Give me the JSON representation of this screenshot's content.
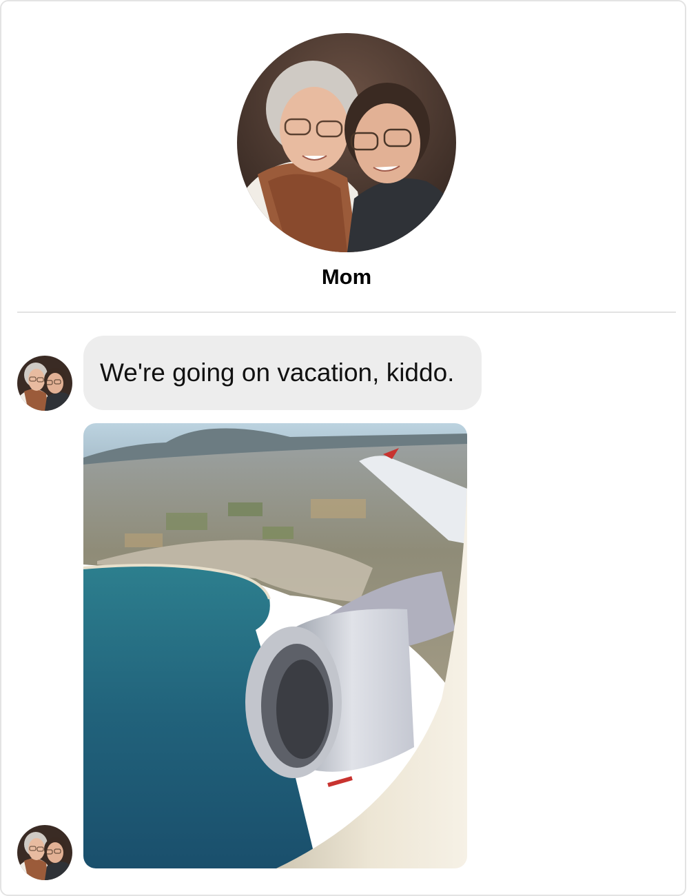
{
  "contact": {
    "name": "Mom"
  },
  "messages": [
    {
      "type": "text",
      "sender": "Mom",
      "text": "We're going on vacation, kiddo."
    },
    {
      "type": "image",
      "sender": "Mom"
    }
  ],
  "colors": {
    "bubble_background": "#ededed",
    "divider": "#e3e3e3",
    "text": "#111111"
  },
  "icons": [
    "contact-avatar-photo",
    "airplane-window-photo"
  ]
}
